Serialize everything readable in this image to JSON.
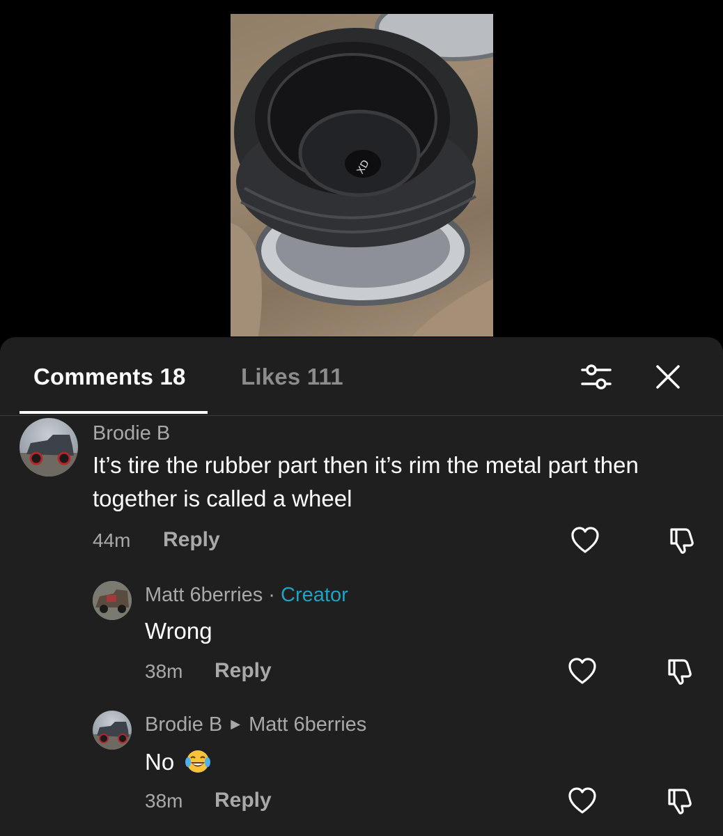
{
  "tabs": {
    "comments_label": "Comments 18",
    "likes_label": "Likes 111"
  },
  "icons": {
    "filter": "sliders-icon",
    "close": "close-icon",
    "like": "heart-icon",
    "dislike": "thumbs-down-icon"
  },
  "colors": {
    "sheet_background": "#1f1f1f",
    "creator_accent": "#1fa2c4",
    "muted_text": "#a9a9a9"
  },
  "comments": [
    {
      "author": "Brodie B",
      "text": "It’s tire the rubber part then it’s rim the metal part then together is called a wheel",
      "time": "44m",
      "reply_label": "Reply"
    },
    {
      "author": "Matt 6berries",
      "separator": "·",
      "badge": "Creator",
      "text": "Wrong",
      "time": "38m",
      "reply_label": "Reply"
    },
    {
      "author": "Brodie B",
      "reply_to": "Matt 6berries",
      "text": "No",
      "emoji": "face-with-tears-of-joy",
      "time": "38m",
      "reply_label": "Reply"
    }
  ]
}
